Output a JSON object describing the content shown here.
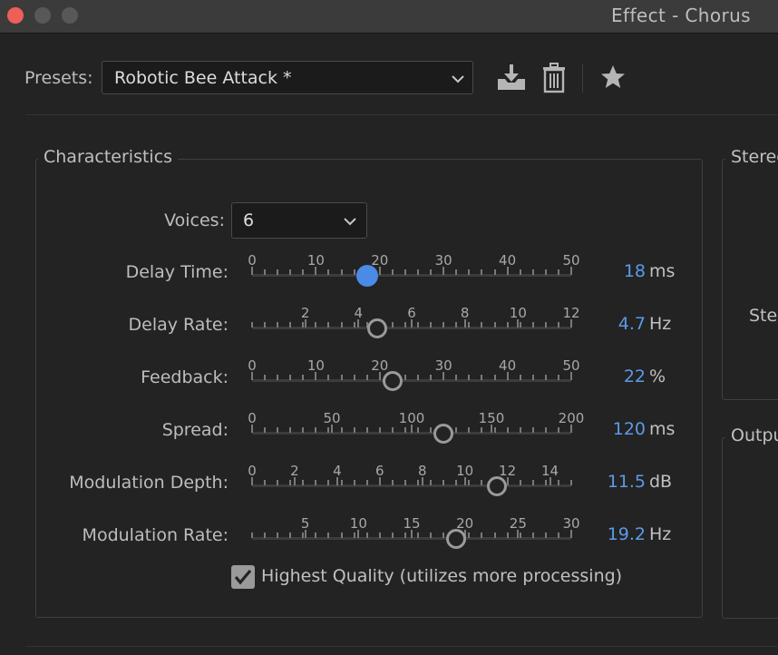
{
  "window": {
    "title": "Effect - Chorus",
    "controls": [
      "close-button",
      "minimize-button",
      "maximize-button"
    ]
  },
  "presets": {
    "label": "Presets:",
    "value": "Robotic Bee Attack *",
    "icons": [
      "download-preset-icon",
      "trash-icon",
      "star-icon"
    ]
  },
  "characteristics": {
    "title": "Characteristics",
    "voices": {
      "label": "Voices:",
      "value": "6"
    },
    "params": [
      {
        "label": "Delay Time:",
        "value": "18",
        "unit": "ms",
        "min": 0,
        "max": 50,
        "current": 18,
        "ticks": [
          "0",
          "10",
          "20",
          "30",
          "40",
          "50"
        ],
        "tick_values": [
          0,
          10,
          20,
          30,
          40,
          50
        ],
        "active": true
      },
      {
        "label": "Delay Rate:",
        "value": "4.7",
        "unit": "Hz",
        "min": 0,
        "max": 12,
        "current": 4.7,
        "ticks": [
          "2",
          "4",
          "6",
          "8",
          "10",
          "12"
        ],
        "tick_values": [
          2,
          4,
          6,
          8,
          10,
          12
        ],
        "active": false
      },
      {
        "label": "Feedback:",
        "value": "22",
        "unit": "%",
        "min": 0,
        "max": 50,
        "current": 22,
        "ticks": [
          "0",
          "10",
          "20",
          "30",
          "40",
          "50"
        ],
        "tick_values": [
          0,
          10,
          20,
          30,
          40,
          50
        ],
        "active": false
      },
      {
        "label": "Spread:",
        "value": "120",
        "unit": "ms",
        "min": 0,
        "max": 200,
        "current": 120,
        "ticks": [
          "0",
          "50",
          "100",
          "150",
          "200"
        ],
        "tick_values": [
          0,
          50,
          100,
          150,
          200
        ],
        "active": false
      },
      {
        "label": "Modulation Depth:",
        "value": "11.5",
        "unit": "dB",
        "min": 0,
        "max": 15,
        "current": 11.5,
        "ticks": [
          "0",
          "2",
          "4",
          "6",
          "8",
          "10",
          "12",
          "14"
        ],
        "tick_values": [
          0,
          2,
          4,
          6,
          8,
          10,
          12,
          14
        ],
        "active": false
      },
      {
        "label": "Modulation Rate:",
        "value": "19.2",
        "unit": "Hz",
        "min": 0,
        "max": 30,
        "current": 19.2,
        "ticks": [
          "5",
          "10",
          "15",
          "20",
          "25",
          "30"
        ],
        "tick_values": [
          5,
          10,
          15,
          20,
          25,
          30
        ],
        "active": false
      }
    ],
    "highest_quality": {
      "label": "Highest Quality (utilizes more processing)",
      "checked": true
    }
  },
  "side_panels": {
    "stereo_title": "Stereo",
    "stereo_item": "Step",
    "output_title": "Output"
  },
  "colors": {
    "accent": "#5b9ae8",
    "thumb_active": "#4b8ae6",
    "close": "#ee5f57"
  }
}
